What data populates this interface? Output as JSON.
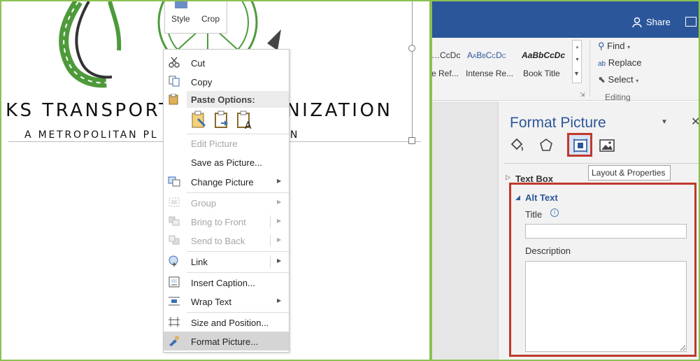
{
  "mini_toolbar": {
    "style_label": "Style",
    "crop_label": "Crop"
  },
  "document": {
    "logo_main": "KS TRANSPORT          GANIZATION",
    "logo_sub": "A METROPOLITAN PL                    ATION"
  },
  "context_menu": {
    "items": [
      {
        "label": "Cut",
        "icon": "scissors-icon",
        "disabled": false
      },
      {
        "label": "Copy",
        "icon": "copy-icon",
        "disabled": false
      },
      {
        "label": "Paste Options:",
        "icon": "clipboard-icon",
        "disabled": false
      },
      {
        "label": "Edit Picture",
        "icon": "",
        "disabled": true
      },
      {
        "label": "Save as Picture...",
        "icon": "",
        "disabled": false
      },
      {
        "label": "Change Picture",
        "icon": "change-picture-icon",
        "disabled": false,
        "submenu": true
      },
      {
        "label": "Group",
        "icon": "group-icon",
        "disabled": true,
        "submenu": true
      },
      {
        "label": "Bring to Front",
        "icon": "bring-front-icon",
        "disabled": true,
        "submenu": true
      },
      {
        "label": "Send to Back",
        "icon": "send-back-icon",
        "disabled": true,
        "submenu": true
      },
      {
        "label": "Link",
        "icon": "link-icon",
        "disabled": false,
        "submenu": true
      },
      {
        "label": "Insert Caption...",
        "icon": "caption-icon",
        "disabled": false
      },
      {
        "label": "Wrap Text",
        "icon": "wrap-text-icon",
        "disabled": false,
        "submenu": true
      },
      {
        "label": "Size and Position...",
        "icon": "size-position-icon",
        "disabled": false
      },
      {
        "label": "Format Picture...",
        "icon": "format-picture-icon",
        "disabled": false,
        "highlighted": true
      }
    ]
  },
  "title_bar": {
    "share_label": "Share"
  },
  "ribbon": {
    "styles": [
      {
        "preview": "…CcDc",
        "name": "e Ref..."
      },
      {
        "preview": "AaBbCcDc",
        "name": "Intense Re..."
      },
      {
        "preview": "AaBbCcDc",
        "name": "Book Title"
      }
    ],
    "editing": {
      "find": "Find",
      "replace": "Replace",
      "select": "Select",
      "group_label": "Editing"
    }
  },
  "format_pane": {
    "title": "Format Picture",
    "tooltip": "Layout & Properties",
    "text_box_label": "Text Box",
    "alt_text_label": "Alt Text",
    "title_label": "Title",
    "description_label": "Description",
    "title_value": "",
    "description_value": ""
  },
  "colors": {
    "word_blue": "#2b579a",
    "highlight_red": "#c0392b",
    "frame_green": "#8cc152"
  }
}
